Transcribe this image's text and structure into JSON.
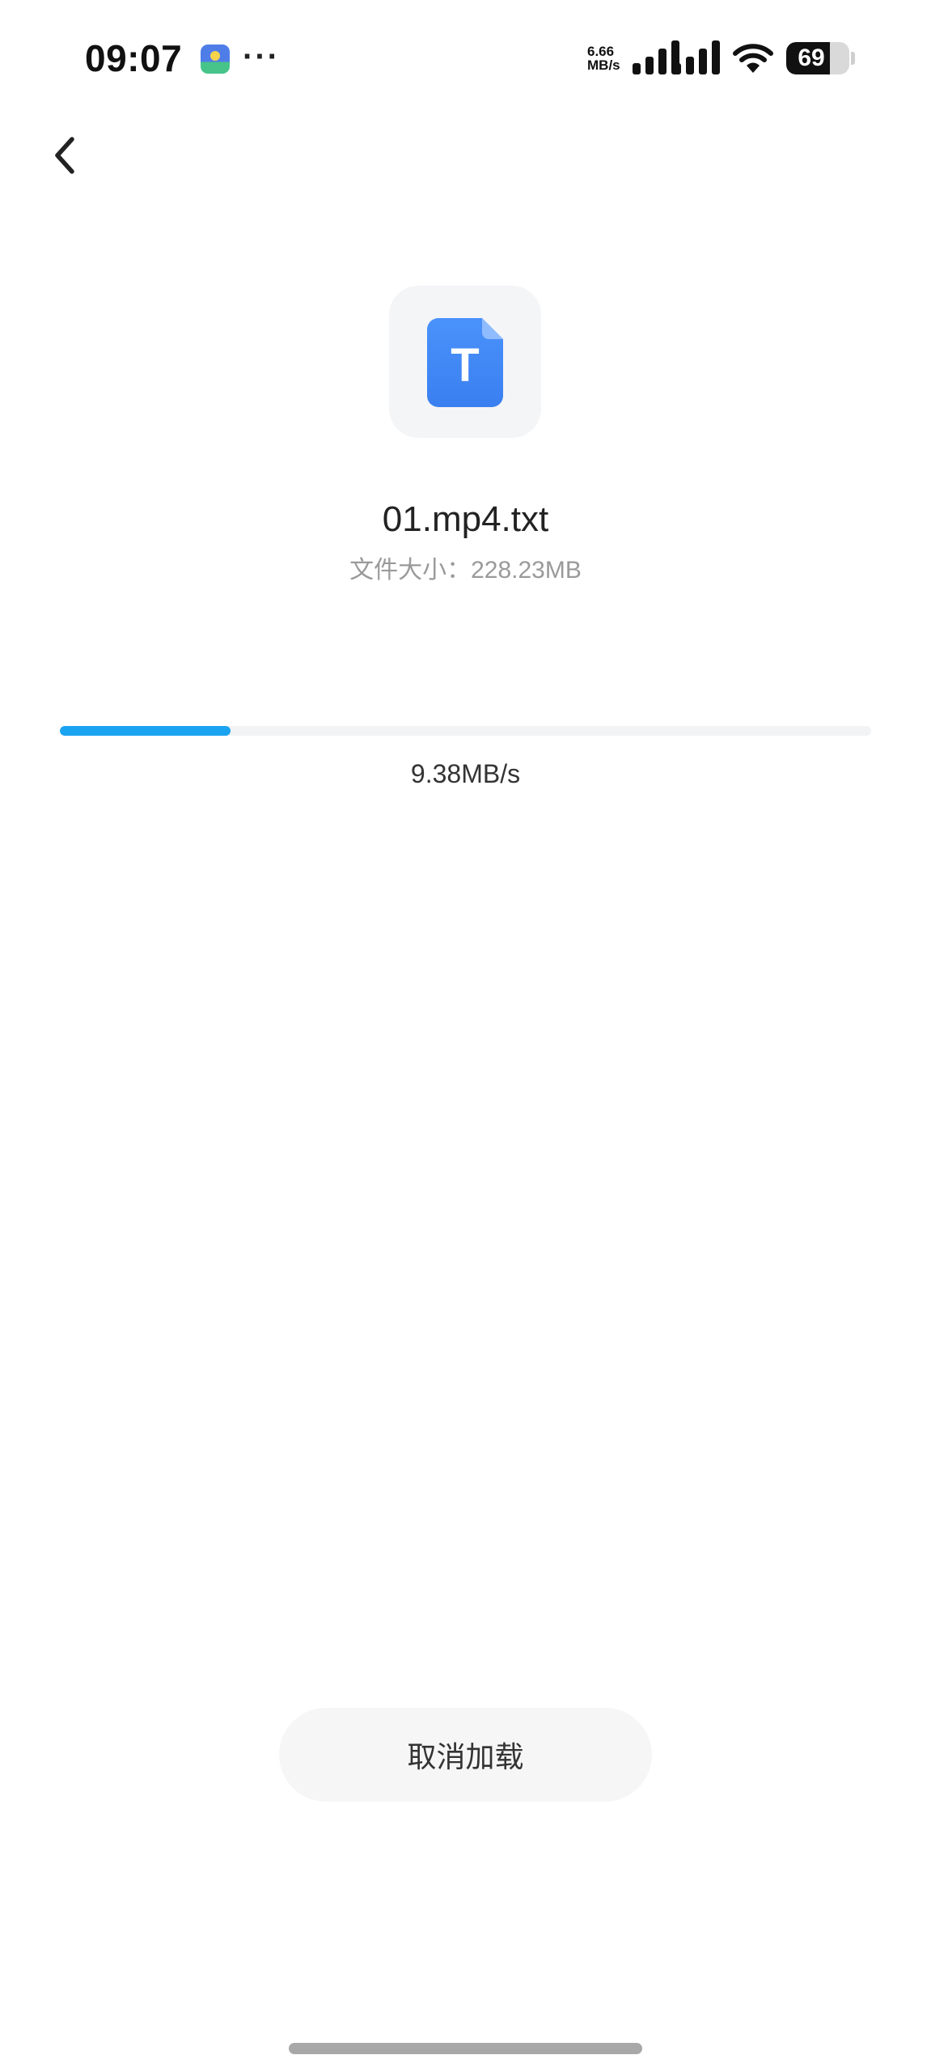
{
  "status_bar": {
    "time": "09:07",
    "more": "···",
    "network_speed_value": "6.66",
    "network_speed_unit": "MB/s",
    "battery_level": "69",
    "battery_fraction": 0.69,
    "app_icon": "gallery-app-icon",
    "signal_icons": [
      "signal-bars-icon",
      "signal-bars-icon"
    ],
    "wifi_icon": "wifi-icon"
  },
  "nav": {
    "back_icon": "chevron-left-icon"
  },
  "file": {
    "icon": "text-file-icon",
    "icon_letter": "T",
    "icon_color": "#3b82f6",
    "name": "01.mp4.txt",
    "size_text": "文件大小：228.23MB"
  },
  "download": {
    "progress_fraction": 0.21,
    "speed": "9.38MB/s",
    "progress_color": "#1aa3f0"
  },
  "actions": {
    "cancel_label": "取消加载"
  }
}
